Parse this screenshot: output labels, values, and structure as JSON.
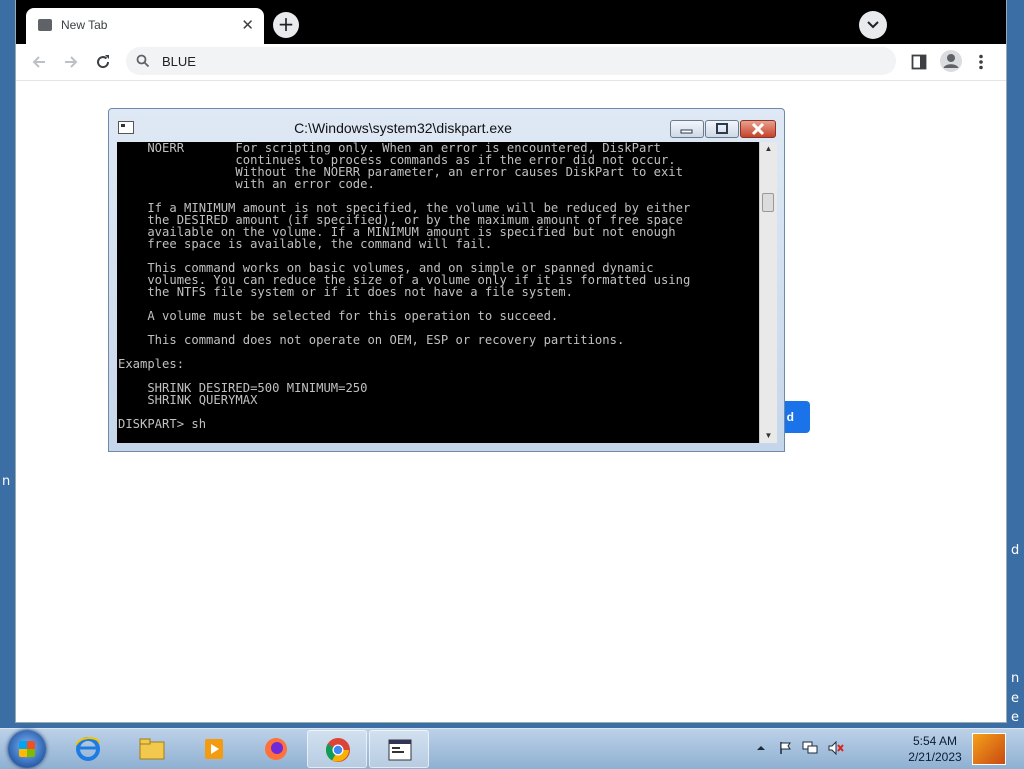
{
  "desktop": {
    "edge_letters": [
      "n",
      "d",
      "n",
      "e",
      "e"
    ]
  },
  "browser": {
    "tab": {
      "title": "New Tab",
      "close_glyph": "✕",
      "favicon": "document-icon"
    },
    "new_tab_glyph": "+",
    "address_bar": {
      "value": "BLUE"
    },
    "page_button_label": "d"
  },
  "console": {
    "title": "C:\\Windows\\system32\\diskpart.exe",
    "lines": [
      "    NOERR       For scripting only. When an error is encountered, DiskPart",
      "                continues to process commands as if the error did not occur.",
      "                Without the NOERR parameter, an error causes DiskPart to exit",
      "                with an error code.",
      "",
      "    If a MINIMUM amount is not specified, the volume will be reduced by either",
      "    the DESIRED amount (if specified), or by the maximum amount of free space",
      "    available on the volume. If a MINIMUM amount is specified but not enough",
      "    free space is available, the command will fail.",
      "",
      "    This command works on basic volumes, and on simple or spanned dynamic",
      "    volumes. You can reduce the size of a volume only if it is formatted using",
      "    the NTFS file system or if it does not have a file system.",
      "",
      "    A volume must be selected for this operation to succeed.",
      "",
      "    This command does not operate on OEM, ESP or recovery partitions.",
      "",
      "Examples:",
      "",
      "    SHRINK DESIRED=500 MINIMUM=250",
      "    SHRINK QUERYMAX",
      "",
      "DISKPART> sh"
    ]
  },
  "taskbar": {
    "items": [
      {
        "name": "internet-explorer",
        "icon": "ie-icon"
      },
      {
        "name": "file-explorer",
        "icon": "folder-icon"
      },
      {
        "name": "media-player",
        "icon": "media-icon"
      },
      {
        "name": "firefox",
        "icon": "firefox-icon"
      },
      {
        "name": "chrome",
        "icon": "chrome-icon",
        "active": true
      },
      {
        "name": "diskpart",
        "icon": "console-icon",
        "active": true
      }
    ],
    "clock": {
      "time": "5:54 AM",
      "date": "2/21/2023"
    }
  },
  "colors": {
    "console_bg": "#000000",
    "console_fg": "#c0c0c0",
    "accent": "#1a73e8",
    "taskbar": "#a9c3df"
  }
}
